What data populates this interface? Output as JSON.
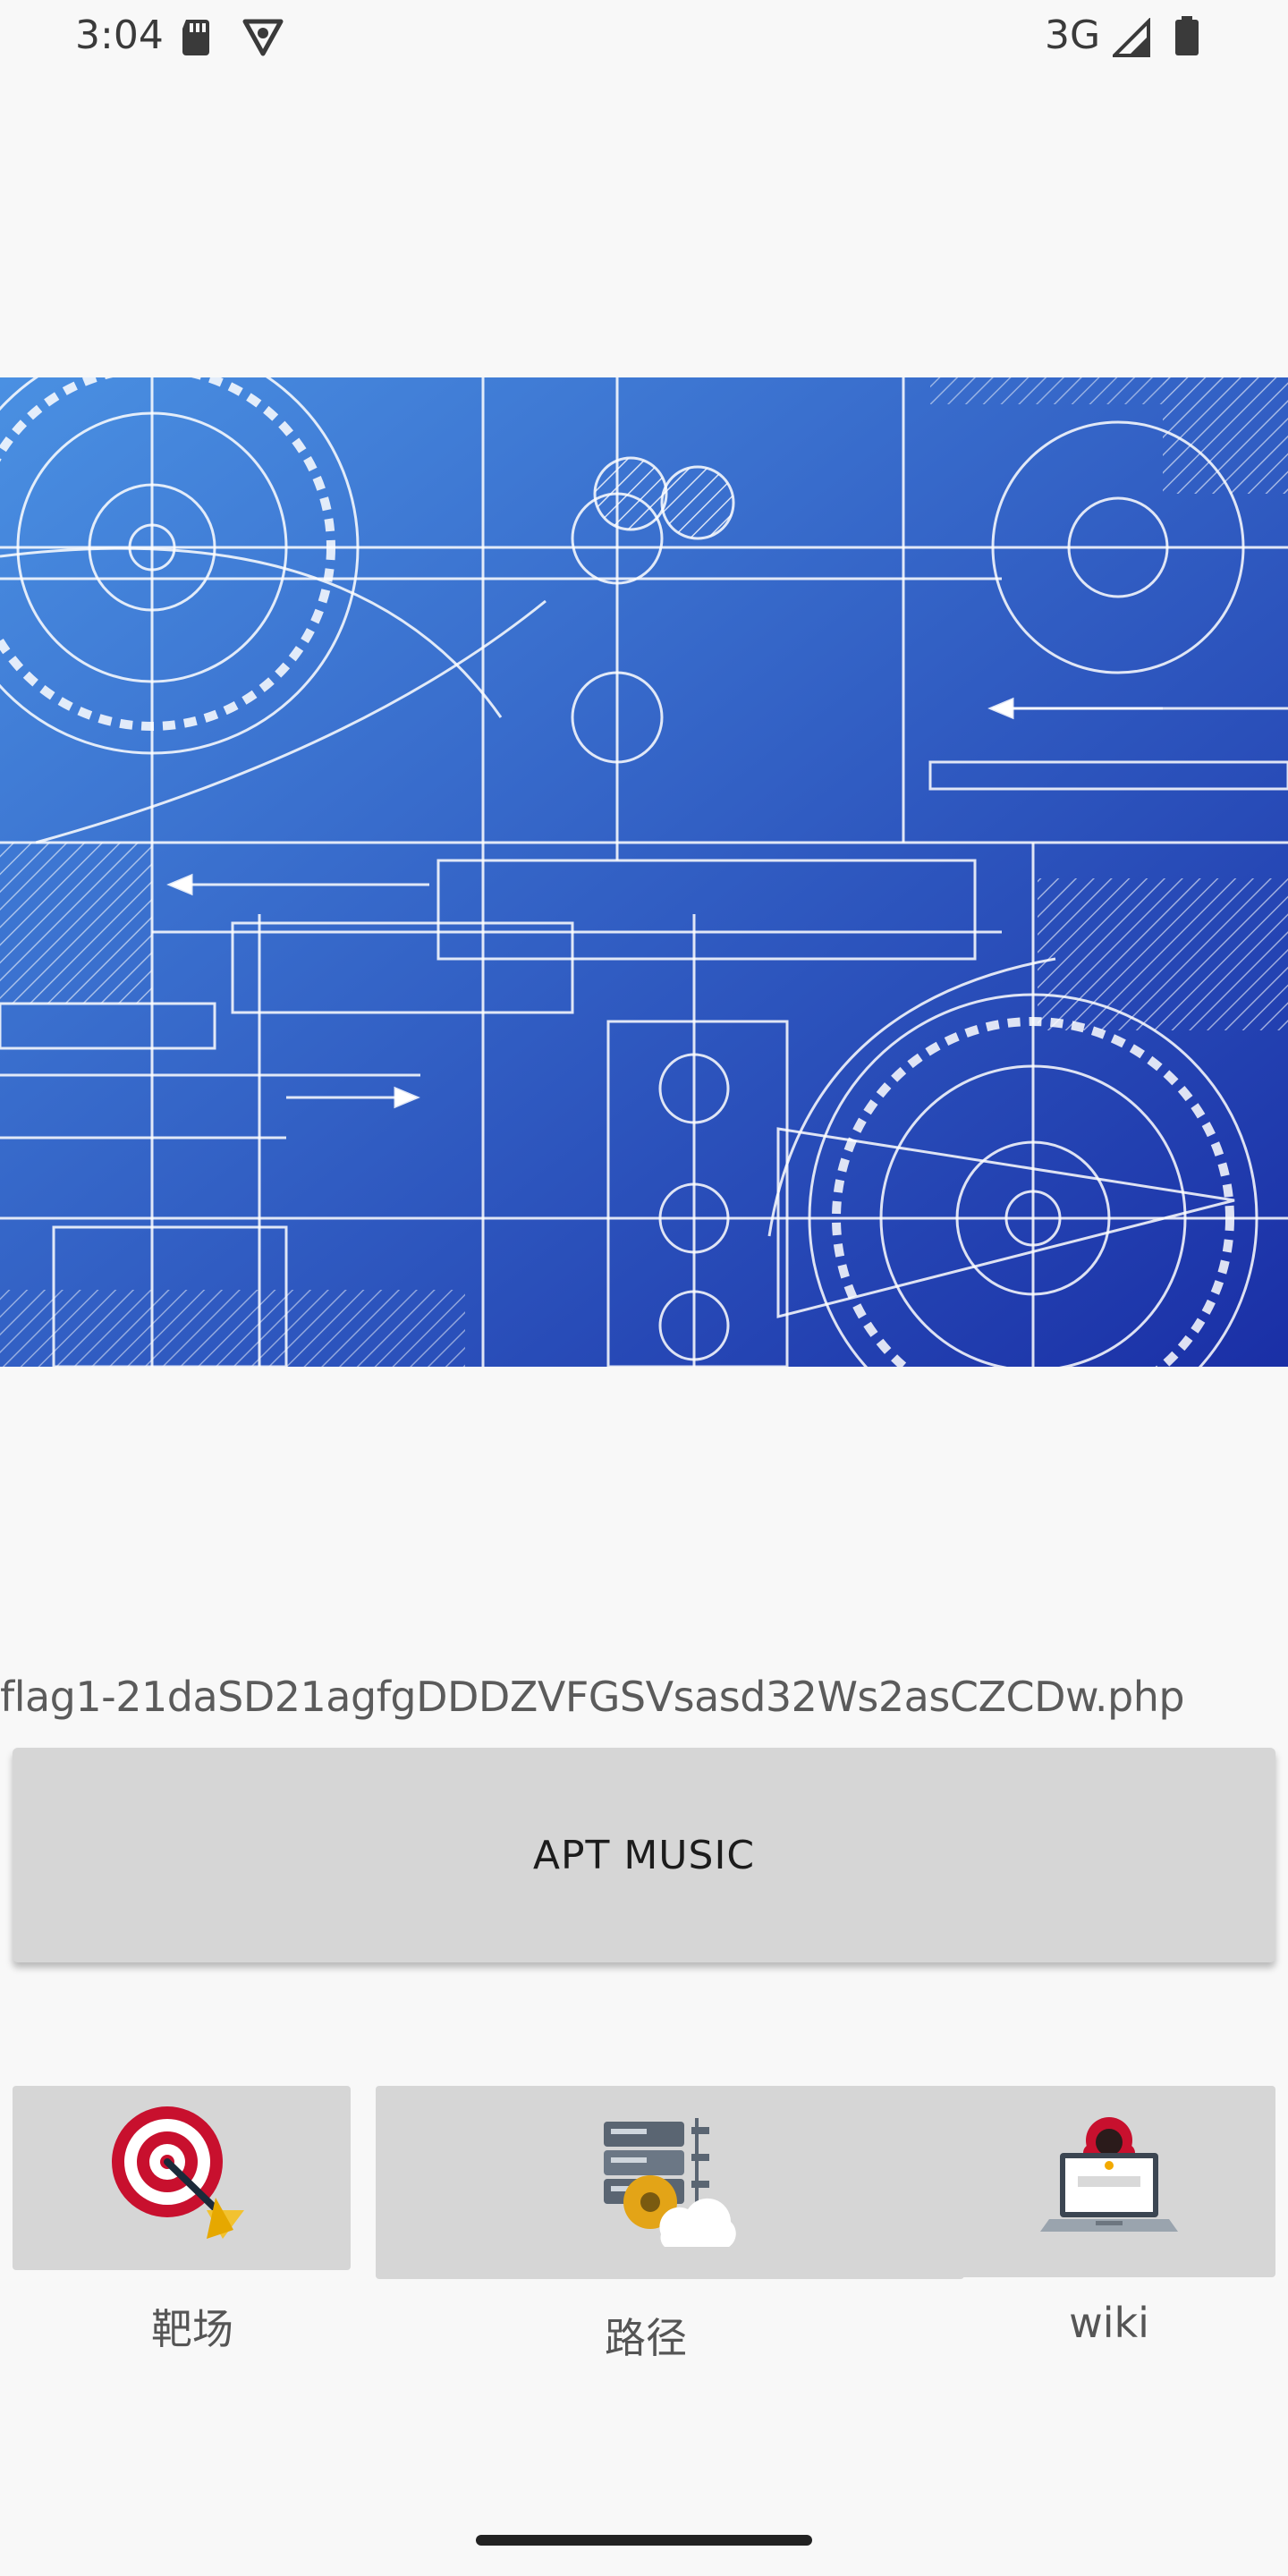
{
  "status_bar": {
    "time": "3:04",
    "network": "3G",
    "icons": [
      "sd-card-icon",
      "vpn-icon",
      "signal-icon",
      "battery-icon"
    ]
  },
  "banner": {
    "image": "blueprint-gears-illustration",
    "colors": {
      "light": "#4a90e2",
      "dark": "#1a2fa6",
      "lines": "#ffffff"
    }
  },
  "main": {
    "flag_text": "flag1-21daSD21agfgDDDZVFGSVsasd32Ws2asCZCDw.php",
    "apt_button_label": "APT MUSIC"
  },
  "tiles": [
    {
      "label": "靶场",
      "icon": "target-icon"
    },
    {
      "label": "路径",
      "icon": "server-gear-cloud-icon"
    },
    {
      "label": "wiki",
      "icon": "hacker-laptop-icon"
    }
  ],
  "colors": {
    "background": "#f8f8f8",
    "button": "#d6d6d6",
    "label": "#555555"
  }
}
